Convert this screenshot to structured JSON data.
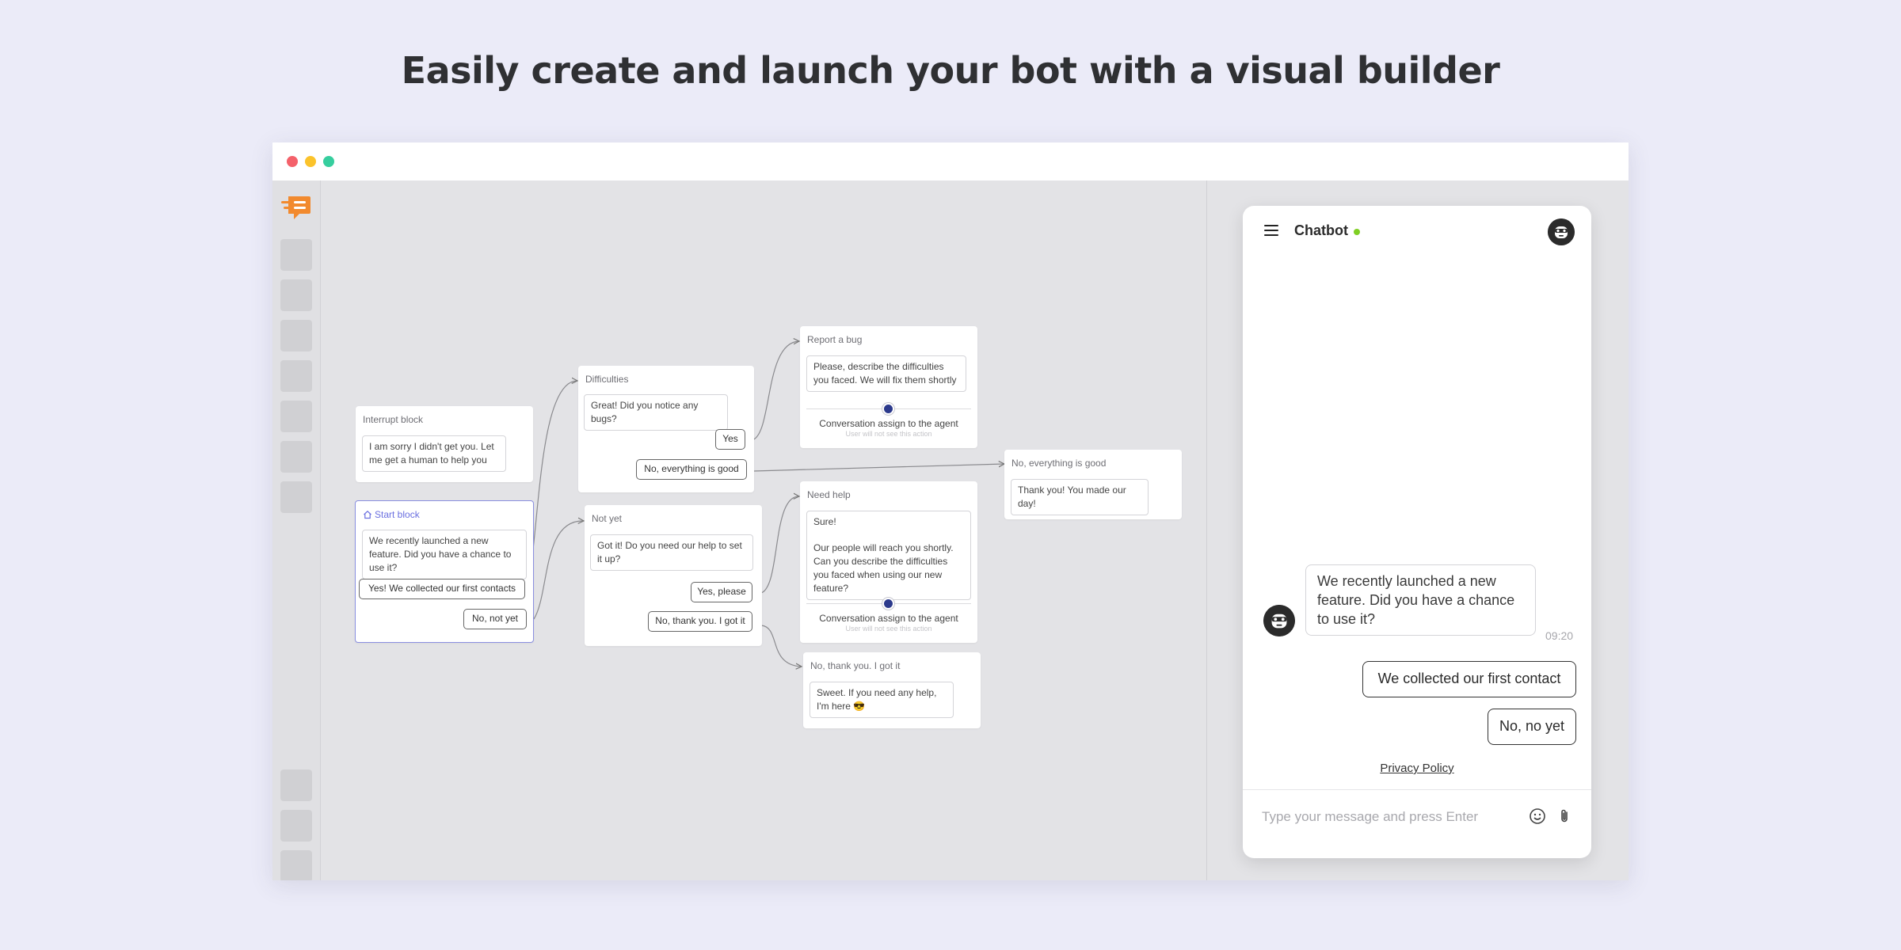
{
  "headline": "Easily create and launch your bot with a visual builder",
  "colors": {
    "background": "#ebebf8",
    "accent_start_block": "#6a6fe0",
    "logo": "#f28a2e",
    "online": "#7fcf24"
  },
  "sidebar": {
    "logo_icon": "chat-bubble-logo-icon",
    "items_top_count_visible": 7,
    "items_bottom_count_visible": 3
  },
  "flow": {
    "interrupt_block": {
      "title": "Interrupt block",
      "message": "I am sorry I didn't get you. Let me get a human to help you"
    },
    "start_block": {
      "title": "Start block",
      "message": "We recently launched a new feature. Did you have a chance to use it?",
      "buttons": [
        "Yes! We collected our first contacts",
        "No, not yet"
      ]
    },
    "difficulties_block": {
      "title": "Difficulties",
      "message": "Great! Did you notice any bugs?",
      "buttons": [
        "Yes",
        "No, everything is good"
      ]
    },
    "not_yet_block": {
      "title": "Not yet",
      "message": "Got it! Do you need our help to set it up?",
      "buttons": [
        "Yes, please",
        "No, thank you. I got it"
      ]
    },
    "report_bug_block": {
      "title": "Report a bug",
      "message": "Please, describe the difficulties you faced. We will fix them shortly",
      "assign": "Conversation assign to the agent",
      "assign_note": "User will not see this action"
    },
    "need_help_block": {
      "title": "Need help",
      "message_line1": "Sure!",
      "message_line2": "Our people will reach you shortly. Can you describe the difficulties you faced when using our new feature?",
      "assign": "Conversation assign to the agent",
      "assign_note": "User will not see this action"
    },
    "got_it_block": {
      "title": "No, thank you. I got it",
      "message": "Sweet. If you need any help, I'm here 😎"
    },
    "everything_good_block": {
      "title": "No, everything is good",
      "message": "Thank you! You made our day!"
    }
  },
  "chat": {
    "title": "Chatbot",
    "status": "online",
    "bot_message": "We recently launched a new feature. Did you have a chance to use it?",
    "bot_message_time": "09:20",
    "quick_replies": [
      "We collected our first contact",
      "No, no yet"
    ],
    "privacy_link": "Privacy Policy",
    "input_placeholder": "Type your message and press Enter",
    "icons": [
      "menu-icon",
      "bot-avatar-icon",
      "emoji-icon",
      "attachment-icon"
    ]
  }
}
